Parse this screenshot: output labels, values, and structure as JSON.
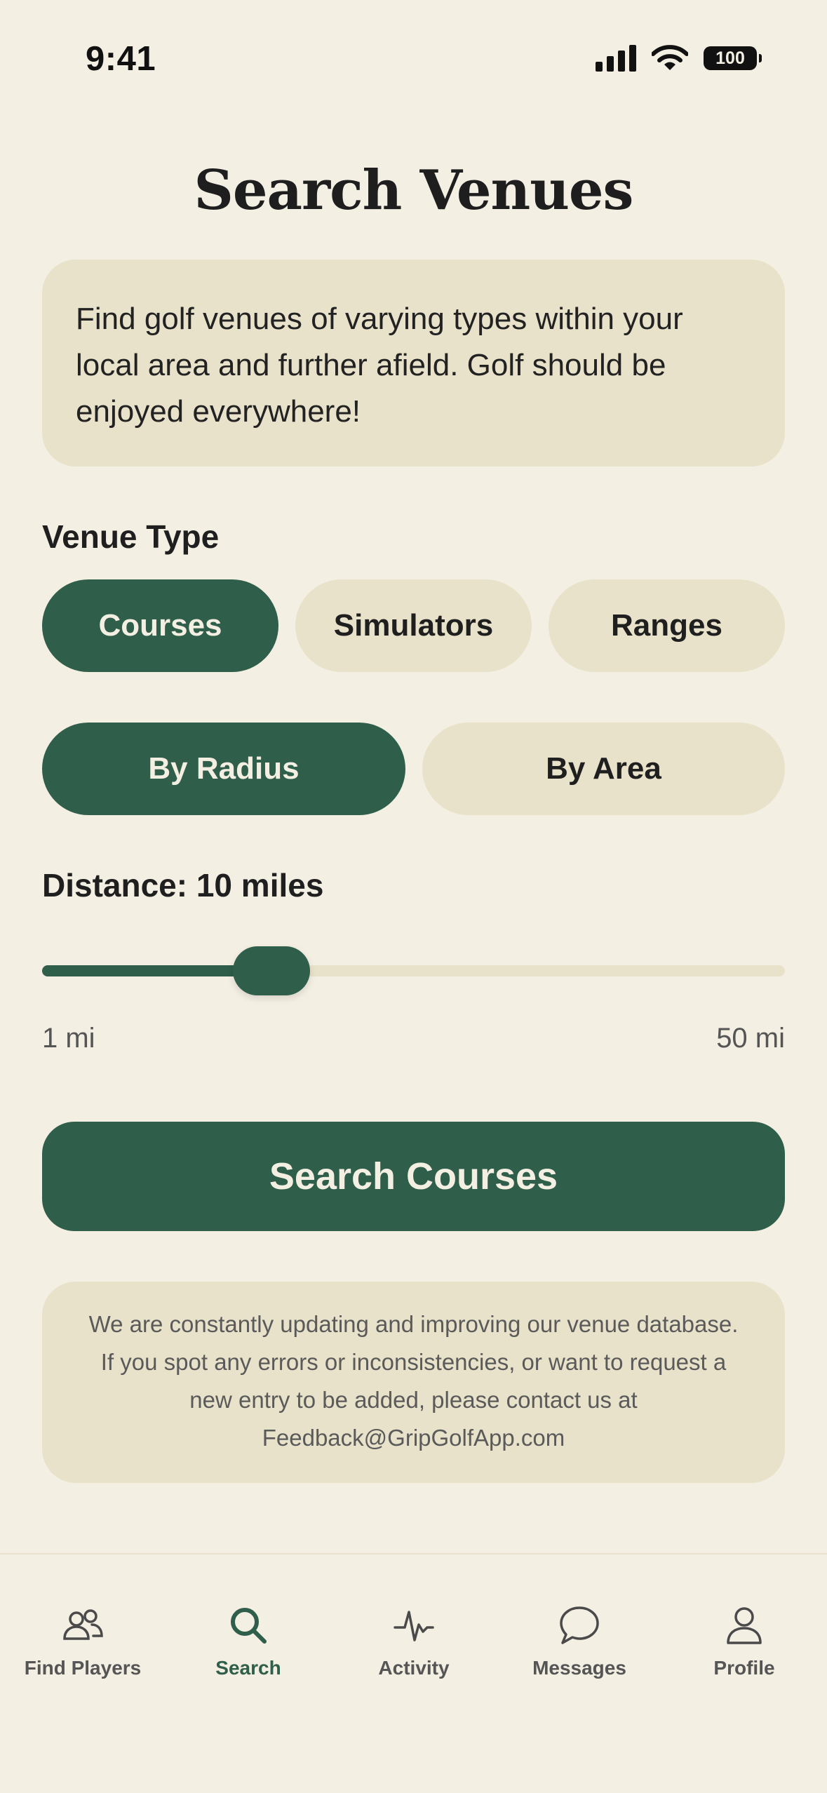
{
  "status_bar": {
    "time": "9:41",
    "battery": "100"
  },
  "header": {
    "title": "Search Venues"
  },
  "intro": {
    "text": "Find golf venues of varying types within your local area and further afield. Golf should be enjoyed everywhere!"
  },
  "venue_type": {
    "label": "Venue Type",
    "options": [
      "Courses",
      "Simulators",
      "Ranges"
    ],
    "selected": "Courses"
  },
  "search_mode": {
    "options": [
      "By Radius",
      "By Area"
    ],
    "selected": "By Radius"
  },
  "distance": {
    "label": "Distance: 10 miles",
    "min_label": "1 mi",
    "max_label": "50 mi",
    "value_miles": 10,
    "min_miles": 1,
    "max_miles": 50
  },
  "search_button": {
    "label": "Search Courses"
  },
  "notice": {
    "text": "We are constantly updating and improving our venue database. If you spot any errors or inconsistencies, or want to request a new entry to be added, please contact us at Feedback@GripGolfApp.com"
  },
  "tab_bar": {
    "items": [
      {
        "label": "Find Players",
        "icon": "people-icon"
      },
      {
        "label": "Search",
        "icon": "search-icon"
      },
      {
        "label": "Activity",
        "icon": "pulse-icon"
      },
      {
        "label": "Messages",
        "icon": "chat-bubble-icon"
      },
      {
        "label": "Profile",
        "icon": "person-icon"
      }
    ],
    "active": "Search"
  },
  "colors": {
    "background": "#f4efe3",
    "card": "#e9e2ca",
    "accent": "#2f5e4a",
    "text": "#1f1f1f"
  }
}
